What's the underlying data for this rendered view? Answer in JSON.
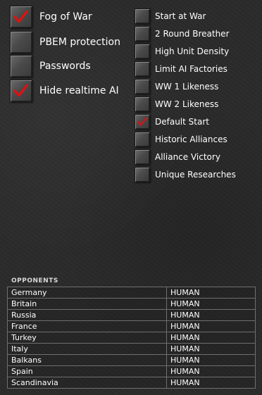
{
  "left_options": [
    {
      "label": "Fog of War",
      "checked": true
    },
    {
      "label": "PBEM protection",
      "checked": false
    },
    {
      "label": "Passwords",
      "checked": false
    },
    {
      "label": "Hide realtime AI",
      "checked": true
    }
  ],
  "right_options": [
    {
      "label": "Start at War",
      "checked": false
    },
    {
      "label": "2 Round Breather",
      "checked": false
    },
    {
      "label": "High Unit Density",
      "checked": false
    },
    {
      "label": "Limit AI Factories",
      "checked": false
    },
    {
      "label": "WW 1 Likeness",
      "checked": false
    },
    {
      "label": "WW 2 Likeness",
      "checked": false
    },
    {
      "label": "Default Start",
      "checked": true
    },
    {
      "label": "Historic Alliances",
      "checked": false
    },
    {
      "label": "Alliance Victory",
      "checked": false
    },
    {
      "label": "Unique Researches",
      "checked": false
    }
  ],
  "opponents": {
    "title": "OPPONENTS",
    "rows": [
      {
        "nation": "Germany",
        "player": "HUMAN"
      },
      {
        "nation": "Britain",
        "player": "HUMAN"
      },
      {
        "nation": "Russia",
        "player": "HUMAN"
      },
      {
        "nation": "France",
        "player": "HUMAN"
      },
      {
        "nation": "Turkey",
        "player": "HUMAN"
      },
      {
        "nation": "Italy",
        "player": "HUMAN"
      },
      {
        "nation": "Balkans",
        "player": "HUMAN"
      },
      {
        "nation": "Spain",
        "player": "HUMAN"
      },
      {
        "nation": "Scandinavia",
        "player": "HUMAN"
      }
    ]
  },
  "colors": {
    "checkmark": "#e01010",
    "text": "#ffffff",
    "grid": "#6f6f6f"
  }
}
